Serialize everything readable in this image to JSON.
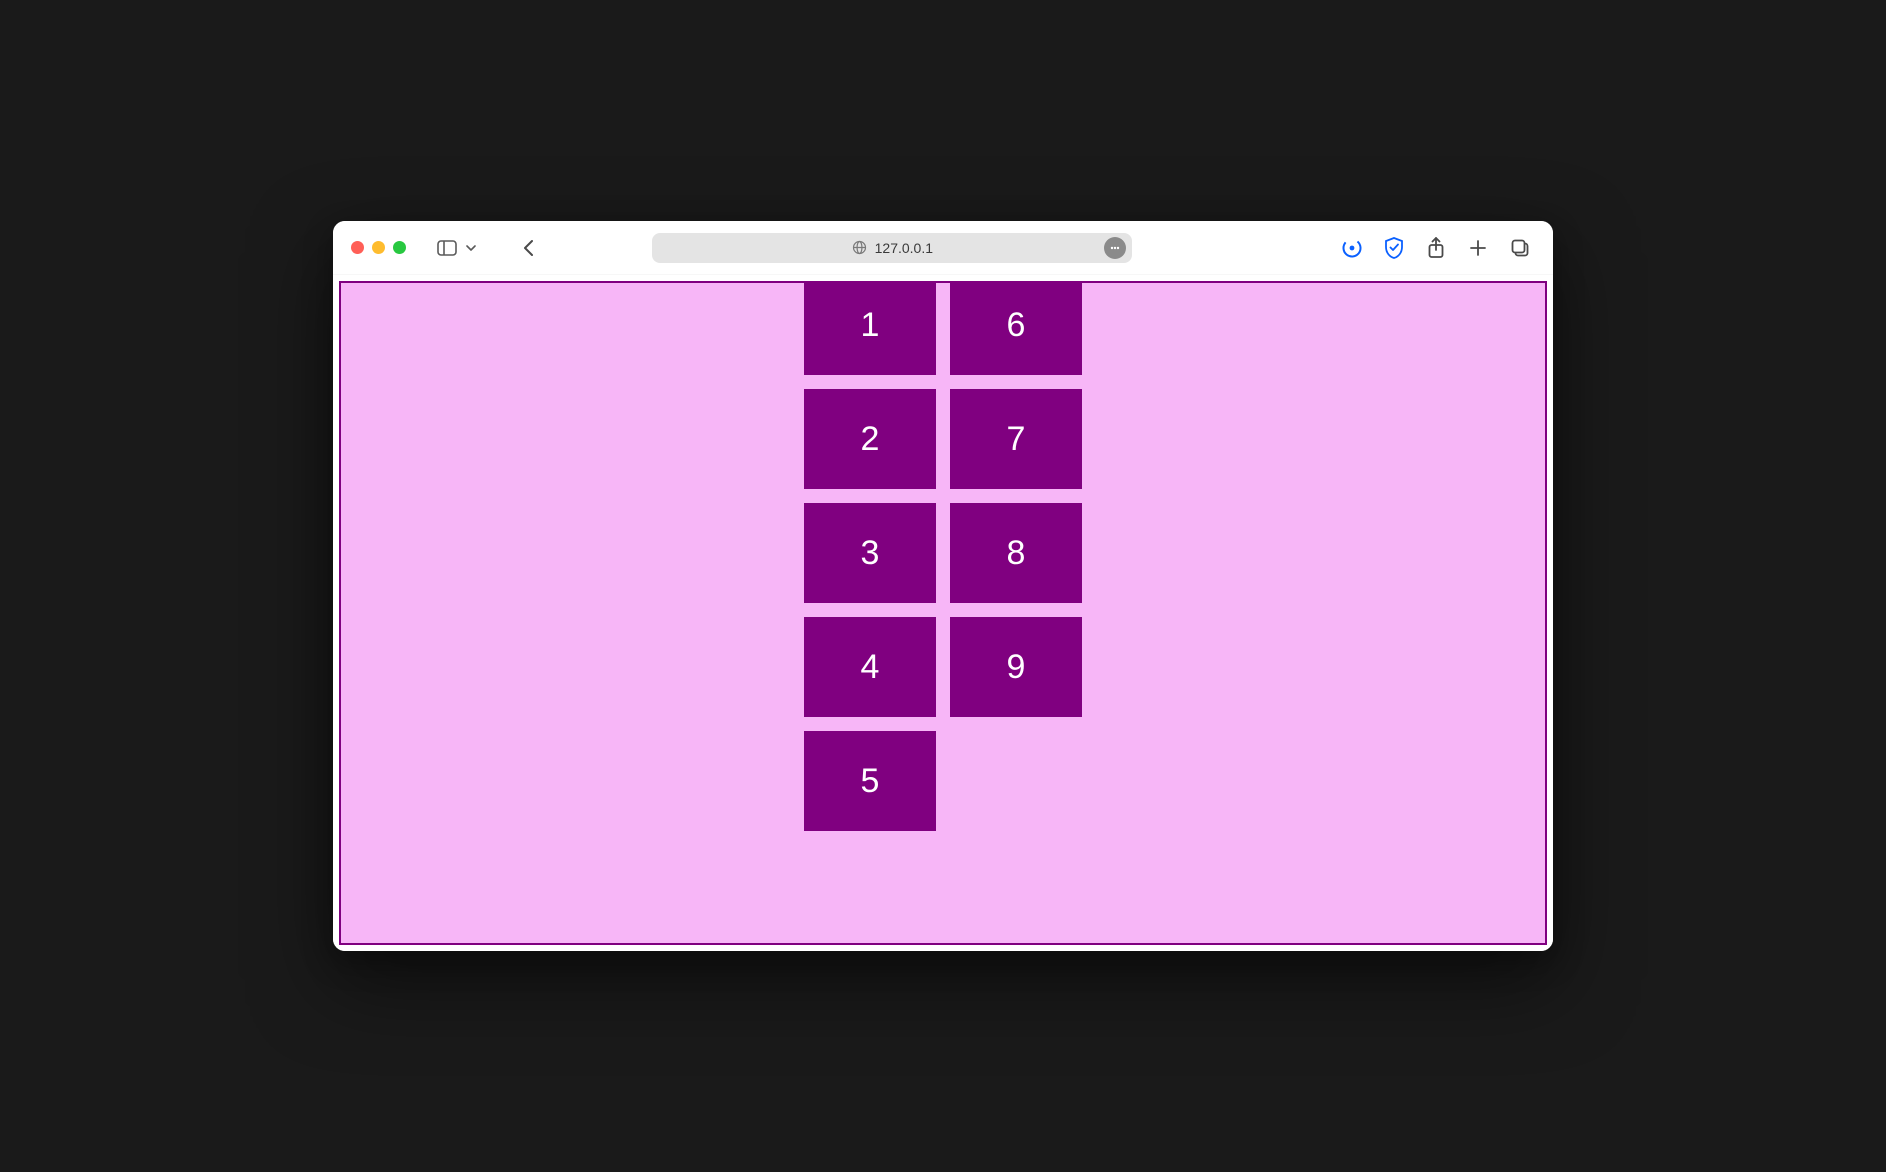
{
  "browser": {
    "address": "127.0.0.1"
  },
  "page": {
    "tiles_col1": [
      "1",
      "2",
      "3",
      "4",
      "5"
    ],
    "tiles_col2": [
      "6",
      "7",
      "8",
      "9"
    ]
  }
}
